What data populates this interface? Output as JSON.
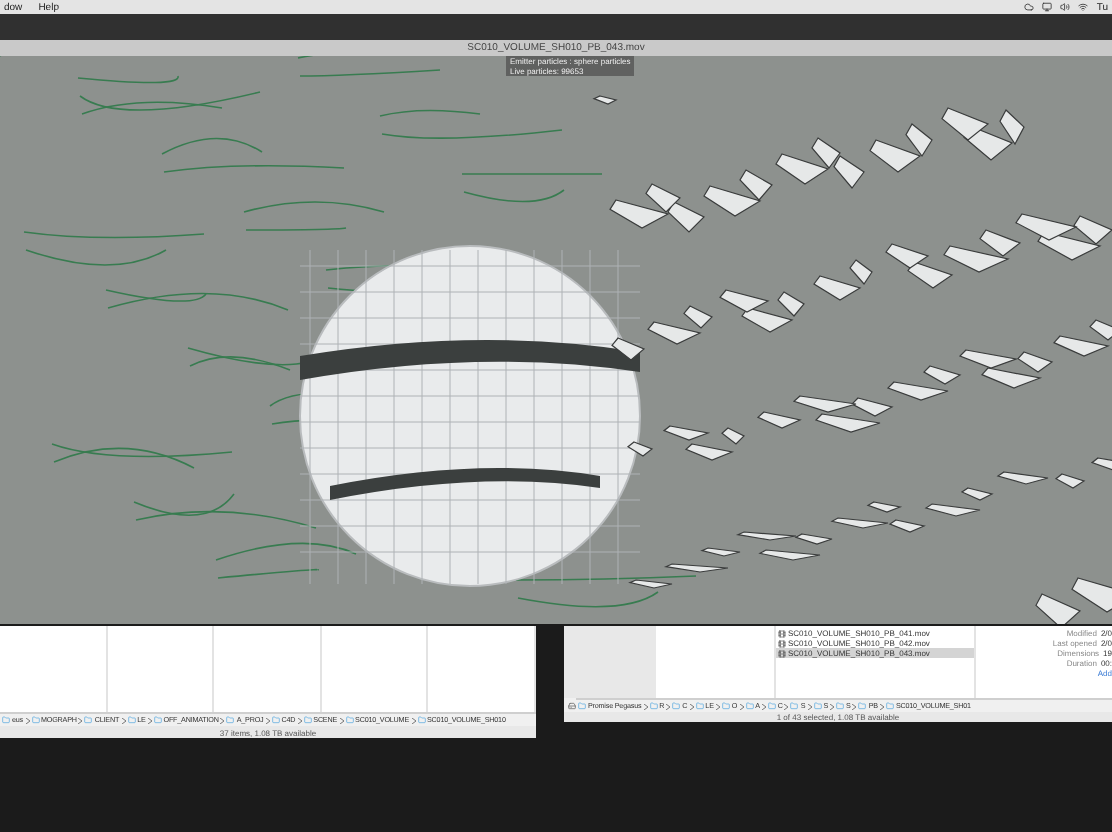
{
  "menu_bar": {
    "items": [
      "dow",
      "Help"
    ],
    "clock": "Tu"
  },
  "video_window": {
    "title": "SC010_VOLUME_SH010_PB_043.mov",
    "overlay": [
      "Emitter particles : sphere particles",
      "Live particles: 99653"
    ]
  },
  "left_finder": {
    "path": [
      "eus",
      "MOGRAPH",
      "CLIENT",
      "LE",
      "OFF_ANIMATION",
      "A_PROJ",
      "C4D",
      "SCENE",
      "SC010_VOLUME",
      "SC010_VOLUME_SH010"
    ],
    "status": "37 items, 1.08 TB available"
  },
  "right_finder": {
    "files": [
      {
        "name": "SC010_VOLUME_SH010_PB_041.mov",
        "selected": false
      },
      {
        "name": "SC010_VOLUME_SH010_PB_042.mov",
        "selected": false
      },
      {
        "name": "SC010_VOLUME_SH010_PB_043.mov",
        "selected": true
      }
    ],
    "info": [
      {
        "label": "Modified",
        "value": "2/0"
      },
      {
        "label": "Last opened",
        "value": "2/0"
      },
      {
        "label": "Dimensions",
        "value": "19"
      },
      {
        "label": "Duration",
        "value": "00:"
      }
    ],
    "add_link": "Add",
    "path": [
      "Promise Pegasus",
      "R",
      "C",
      "LE",
      "O",
      "A",
      "C",
      "S",
      "S",
      "S",
      "PB",
      "SC010_VOLUME_SH01"
    ],
    "status": "1 of 43 selected, 1.08 TB available"
  }
}
